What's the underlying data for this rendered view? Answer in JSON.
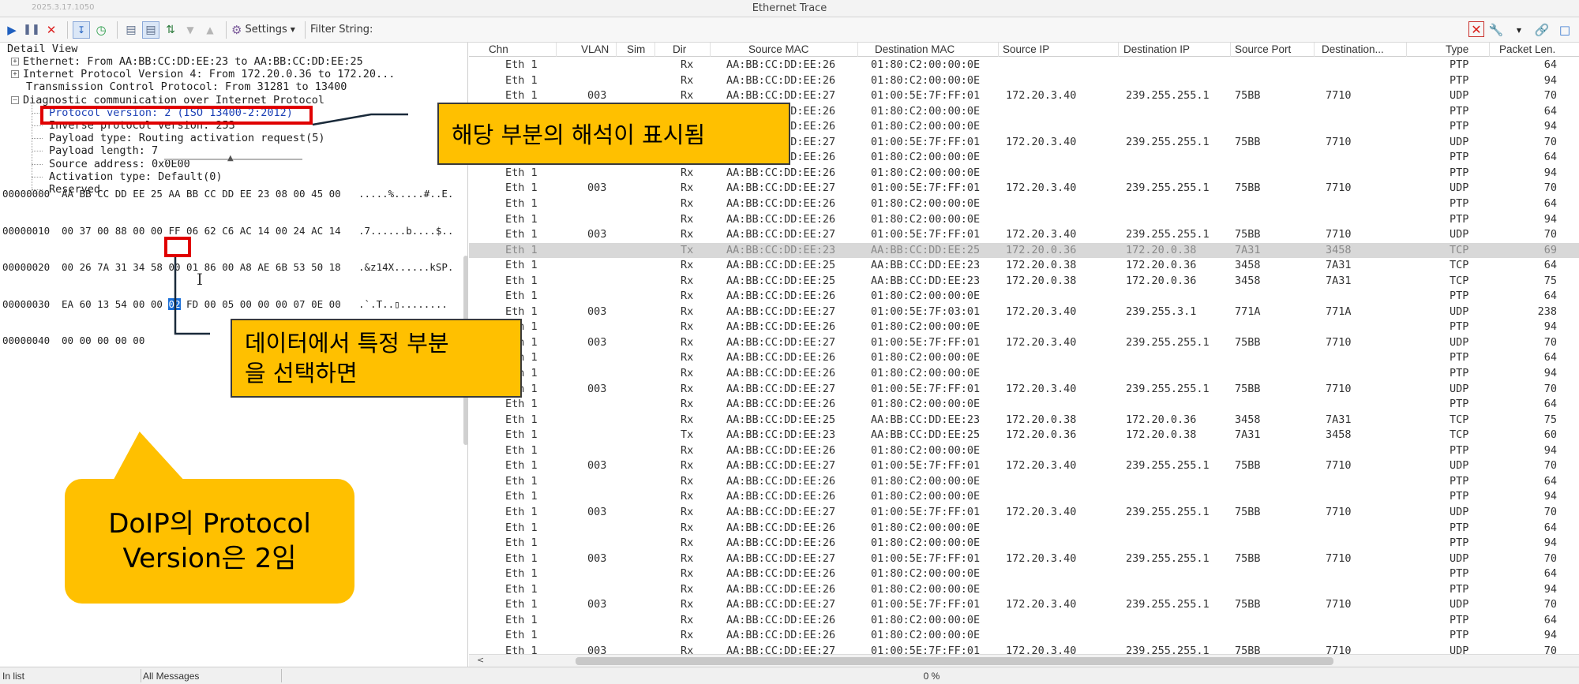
{
  "window": {
    "title": "Ethernet Trace",
    "version": "2025.3.17.1050"
  },
  "toolbar": {
    "settings_label": "Settings",
    "filter_label": "Filter String:"
  },
  "detail": {
    "header": "Detail View",
    "tree": [
      {
        "text": "Ethernet: From AA:BB:CC:DD:EE:23 to AA:BB:CC:DD:EE:25",
        "expander": "+"
      },
      {
        "text": "Internet Protocol Version 4: From 172.20.0.36 to 172.20...",
        "expander": "+"
      },
      {
        "text": "Transmission Control Protocol: From 31281 to 13400",
        "expander": ""
      },
      {
        "text": "Diagnostic communication over Internet Protocol",
        "expander": "-"
      }
    ],
    "children": [
      "Protocol version: 2 (ISO 13400-2:2012)",
      "Inverse protocol version: 253",
      "Payload type: Routing activation request(5)",
      "Payload length: 7",
      "Source address: 0x0E00",
      "Activation type: Default(0)",
      "Reserved"
    ]
  },
  "hex": [
    {
      "addr": "00000000",
      "pre": "AA BB CC DD EE 25 AA BB CC DD EE 23 08 00 45 00",
      "hl": "",
      "post": "",
      "ascii": ".....%.....#..E."
    },
    {
      "addr": "00000010",
      "pre": "00 37 00 88 00 00 FF 06 62 C6 AC 14 00 24 AC 14",
      "hl": "",
      "post": "",
      "ascii": ".7......b....$.."
    },
    {
      "addr": "00000020",
      "pre": "00 26 7A 31 34 58 00 01 86 00 A8 AE 6B 53 50 18",
      "hl": "",
      "post": "",
      "ascii": ".&z14X......kSP."
    },
    {
      "addr": "00000030",
      "pre": "EA 60 13 54 00 00 ",
      "hl": "02",
      "post": " FD 00 05 00 00 00 07 0E 00",
      "ascii": ".`.T..▯........"
    },
    {
      "addr": "00000040",
      "pre": "00 00 00 00 00",
      "hl": "",
      "post": "",
      "ascii": "....."
    }
  ],
  "grid": {
    "columns": [
      "Chn",
      "VLAN",
      "Sim",
      "Dir",
      "Source MAC",
      "Destination MAC",
      "Source IP",
      "Destination IP",
      "Source Port",
      "Destination...",
      "Type",
      "Packet Len."
    ],
    "rows": [
      [
        "Eth 1",
        "",
        "",
        "Rx",
        "AA:BB:CC:DD:EE:26",
        "01:80:C2:00:00:0E",
        "",
        "",
        "",
        "",
        "PTP",
        "64"
      ],
      [
        "Eth 1",
        "",
        "",
        "Rx",
        "AA:BB:CC:DD:EE:26",
        "01:80:C2:00:00:0E",
        "",
        "",
        "",
        "",
        "PTP",
        "94"
      ],
      [
        "Eth 1",
        "003",
        "",
        "Rx",
        "AA:BB:CC:DD:EE:27",
        "01:00:5E:7F:FF:01",
        "172.20.3.40",
        "239.255.255.1",
        "75BB",
        "7710",
        "UDP",
        "70"
      ],
      [
        "Eth 1",
        "",
        "",
        "Rx",
        "AA:BB:CC:DD:EE:26",
        "01:80:C2:00:00:0E",
        "",
        "",
        "",
        "",
        "PTP",
        "64"
      ],
      [
        "Eth 1",
        "",
        "",
        "Rx",
        "AA:BB:CC:DD:EE:26",
        "01:80:C2:00:00:0E",
        "",
        "",
        "",
        "",
        "PTP",
        "94"
      ],
      [
        "Eth 1",
        "003",
        "",
        "Rx",
        "AA:BB:CC:DD:EE:27",
        "01:00:5E:7F:FF:01",
        "172.20.3.40",
        "239.255.255.1",
        "75BB",
        "7710",
        "UDP",
        "70"
      ],
      [
        "Eth 1",
        "",
        "",
        "Rx",
        "AA:BB:CC:DD:EE:26",
        "01:80:C2:00:00:0E",
        "",
        "",
        "",
        "",
        "PTP",
        "64"
      ],
      [
        "Eth 1",
        "",
        "",
        "Rx",
        "AA:BB:CC:DD:EE:26",
        "01:80:C2:00:00:0E",
        "",
        "",
        "",
        "",
        "PTP",
        "94"
      ],
      [
        "Eth 1",
        "003",
        "",
        "Rx",
        "AA:BB:CC:DD:EE:27",
        "01:00:5E:7F:FF:01",
        "172.20.3.40",
        "239.255.255.1",
        "75BB",
        "7710",
        "UDP",
        "70"
      ],
      [
        "Eth 1",
        "",
        "",
        "Rx",
        "AA:BB:CC:DD:EE:26",
        "01:80:C2:00:00:0E",
        "",
        "",
        "",
        "",
        "PTP",
        "64"
      ],
      [
        "Eth 1",
        "",
        "",
        "Rx",
        "AA:BB:CC:DD:EE:26",
        "01:80:C2:00:00:0E",
        "",
        "",
        "",
        "",
        "PTP",
        "94"
      ],
      [
        "Eth 1",
        "003",
        "",
        "Rx",
        "AA:BB:CC:DD:EE:27",
        "01:00:5E:7F:FF:01",
        "172.20.3.40",
        "239.255.255.1",
        "75BB",
        "7710",
        "UDP",
        "70"
      ],
      [
        "Eth 1",
        "",
        "",
        "Tx",
        "AA:BB:CC:DD:EE:23",
        "AA:BB:CC:DD:EE:25",
        "172.20.0.36",
        "172.20.0.38",
        "7A31",
        "3458",
        "TCP",
        "69"
      ],
      [
        "Eth 1",
        "",
        "",
        "Rx",
        "AA:BB:CC:DD:EE:25",
        "AA:BB:CC:DD:EE:23",
        "172.20.0.38",
        "172.20.0.36",
        "3458",
        "7A31",
        "TCP",
        "64"
      ],
      [
        "Eth 1",
        "",
        "",
        "Rx",
        "AA:BB:CC:DD:EE:25",
        "AA:BB:CC:DD:EE:23",
        "172.20.0.38",
        "172.20.0.36",
        "3458",
        "7A31",
        "TCP",
        "75"
      ],
      [
        "Eth 1",
        "",
        "",
        "Rx",
        "AA:BB:CC:DD:EE:26",
        "01:80:C2:00:00:0E",
        "",
        "",
        "",
        "",
        "PTP",
        "64"
      ],
      [
        "Eth 1",
        "003",
        "",
        "Rx",
        "AA:BB:CC:DD:EE:27",
        "01:00:5E:7F:03:01",
        "172.20.3.40",
        "239.255.3.1",
        "771A",
        "771A",
        "UDP",
        "238"
      ],
      [
        "Eth 1",
        "",
        "",
        "Rx",
        "AA:BB:CC:DD:EE:26",
        "01:80:C2:00:00:0E",
        "",
        "",
        "",
        "",
        "PTP",
        "94"
      ],
      [
        "Eth 1",
        "003",
        "",
        "Rx",
        "AA:BB:CC:DD:EE:27",
        "01:00:5E:7F:FF:01",
        "172.20.3.40",
        "239.255.255.1",
        "75BB",
        "7710",
        "UDP",
        "70"
      ],
      [
        "Eth 1",
        "",
        "",
        "Rx",
        "AA:BB:CC:DD:EE:26",
        "01:80:C2:00:00:0E",
        "",
        "",
        "",
        "",
        "PTP",
        "64"
      ],
      [
        "Eth 1",
        "",
        "",
        "Rx",
        "AA:BB:CC:DD:EE:26",
        "01:80:C2:00:00:0E",
        "",
        "",
        "",
        "",
        "PTP",
        "94"
      ],
      [
        "Eth 1",
        "003",
        "",
        "Rx",
        "AA:BB:CC:DD:EE:27",
        "01:00:5E:7F:FF:01",
        "172.20.3.40",
        "239.255.255.1",
        "75BB",
        "7710",
        "UDP",
        "70"
      ],
      [
        "Eth 1",
        "",
        "",
        "Rx",
        "AA:BB:CC:DD:EE:26",
        "01:80:C2:00:00:0E",
        "",
        "",
        "",
        "",
        "PTP",
        "64"
      ],
      [
        "Eth 1",
        "",
        "",
        "Rx",
        "AA:BB:CC:DD:EE:25",
        "AA:BB:CC:DD:EE:23",
        "172.20.0.38",
        "172.20.0.36",
        "3458",
        "7A31",
        "TCP",
        "75"
      ],
      [
        "Eth 1",
        "",
        "",
        "Tx",
        "AA:BB:CC:DD:EE:23",
        "AA:BB:CC:DD:EE:25",
        "172.20.0.36",
        "172.20.0.38",
        "7A31",
        "3458",
        "TCP",
        "60"
      ],
      [
        "Eth 1",
        "",
        "",
        "Rx",
        "AA:BB:CC:DD:EE:26",
        "01:80:C2:00:00:0E",
        "",
        "",
        "",
        "",
        "PTP",
        "94"
      ],
      [
        "Eth 1",
        "003",
        "",
        "Rx",
        "AA:BB:CC:DD:EE:27",
        "01:00:5E:7F:FF:01",
        "172.20.3.40",
        "239.255.255.1",
        "75BB",
        "7710",
        "UDP",
        "70"
      ],
      [
        "Eth 1",
        "",
        "",
        "Rx",
        "AA:BB:CC:DD:EE:26",
        "01:80:C2:00:00:0E",
        "",
        "",
        "",
        "",
        "PTP",
        "64"
      ],
      [
        "Eth 1",
        "",
        "",
        "Rx",
        "AA:BB:CC:DD:EE:26",
        "01:80:C2:00:00:0E",
        "",
        "",
        "",
        "",
        "PTP",
        "94"
      ],
      [
        "Eth 1",
        "003",
        "",
        "Rx",
        "AA:BB:CC:DD:EE:27",
        "01:00:5E:7F:FF:01",
        "172.20.3.40",
        "239.255.255.1",
        "75BB",
        "7710",
        "UDP",
        "70"
      ],
      [
        "Eth 1",
        "",
        "",
        "Rx",
        "AA:BB:CC:DD:EE:26",
        "01:80:C2:00:00:0E",
        "",
        "",
        "",
        "",
        "PTP",
        "64"
      ],
      [
        "Eth 1",
        "",
        "",
        "Rx",
        "AA:BB:CC:DD:EE:26",
        "01:80:C2:00:00:0E",
        "",
        "",
        "",
        "",
        "PTP",
        "94"
      ],
      [
        "Eth 1",
        "003",
        "",
        "Rx",
        "AA:BB:CC:DD:EE:27",
        "01:00:5E:7F:FF:01",
        "172.20.3.40",
        "239.255.255.1",
        "75BB",
        "7710",
        "UDP",
        "70"
      ],
      [
        "Eth 1",
        "",
        "",
        "Rx",
        "AA:BB:CC:DD:EE:26",
        "01:80:C2:00:00:0E",
        "",
        "",
        "",
        "",
        "PTP",
        "64"
      ],
      [
        "Eth 1",
        "",
        "",
        "Rx",
        "AA:BB:CC:DD:EE:26",
        "01:80:C2:00:00:0E",
        "",
        "",
        "",
        "",
        "PTP",
        "94"
      ],
      [
        "Eth 1",
        "003",
        "",
        "Rx",
        "AA:BB:CC:DD:EE:27",
        "01:00:5E:7F:FF:01",
        "172.20.3.40",
        "239.255.255.1",
        "75BB",
        "7710",
        "UDP",
        "70"
      ],
      [
        "Eth 1",
        "",
        "",
        "Rx",
        "AA:BB:CC:DD:EE:26",
        "01:80:C2:00:00:0E",
        "",
        "",
        "",
        "",
        "PTP",
        "64"
      ],
      [
        "Eth 1",
        "",
        "",
        "Rx",
        "AA:BB:CC:DD:EE:26",
        "01:80:C2:00:00:0E",
        "",
        "",
        "",
        "",
        "PTP",
        "94"
      ],
      [
        "Eth 1",
        "003",
        "",
        "Rx",
        "AA:BB:CC:DD:EE:27",
        "01:00:5E:7F:FF:01",
        "172.20.3.40",
        "239.255.255.1",
        "75BB",
        "7710",
        "UDP",
        "70"
      ]
    ],
    "selected_row": 12
  },
  "status": {
    "mode": "In list",
    "filter": "All Messages",
    "progress_pct": 0,
    "progress_label": "0 %"
  },
  "annotations": {
    "callout1": "해당 부분의 해석이 표시됨",
    "callout2_line1": "데이터에서 특정 부분",
    "callout2_line2": "을 선택하면",
    "callout3_line1": "DoIP의 Protocol",
    "callout3_line2": "Version은 2임"
  },
  "colors": {
    "callout": "#ffc000",
    "highlight_box": "#e00000",
    "selected_row": "#d8d8d8",
    "tree_selected_text": "#1a3fb5",
    "hex_highlight": "#1a6fd8"
  }
}
